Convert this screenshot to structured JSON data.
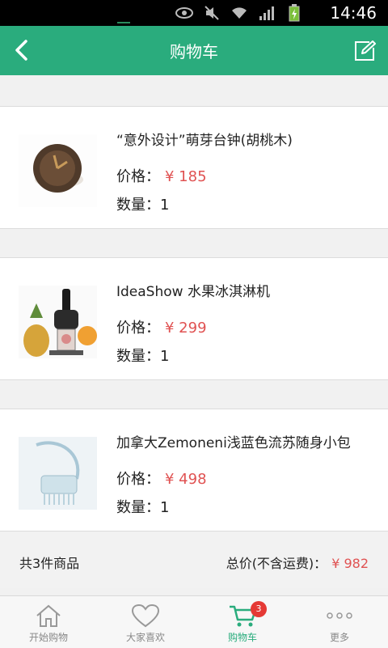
{
  "status_bar": {
    "time": "14:46",
    "icons": [
      "eye-icon",
      "mute-icon",
      "wifi-icon",
      "signal-icon",
      "battery-icon"
    ]
  },
  "header": {
    "title": "购物车",
    "back_icon": "chevron-left-icon",
    "edit_icon": "edit-icon"
  },
  "cart": {
    "items": [
      {
        "name": "“意外设计”萌芽台钟(胡桃木)",
        "price_label": "价格：",
        "price": "¥ 185",
        "qty_label": "数量：",
        "qty": "1"
      },
      {
        "name": "IdeaShow 水果冰淇淋机",
        "price_label": "价格：",
        "price": "¥ 299",
        "qty_label": "数量：",
        "qty": "1"
      },
      {
        "name": "加拿大Zemoneni浅蓝色流苏随身小包",
        "price_label": "价格：",
        "price": "¥ 498",
        "qty_label": "数量：",
        "qty": "1"
      }
    ]
  },
  "summary": {
    "count": "共3件商品",
    "total_label": "总价(不含运费)：",
    "total_amount": "¥ 982"
  },
  "bottom_nav": {
    "items": [
      {
        "label": "开始购物",
        "icon": "home-icon"
      },
      {
        "label": "大家喜欢",
        "icon": "heart-icon"
      },
      {
        "label": "购物车",
        "icon": "cart-icon",
        "badge": "3",
        "active": true
      },
      {
        "label": "更多",
        "icon": "more-icon"
      }
    ]
  },
  "colors": {
    "primary": "#2aac7d",
    "price": "#e05252",
    "badge": "#e53935"
  }
}
